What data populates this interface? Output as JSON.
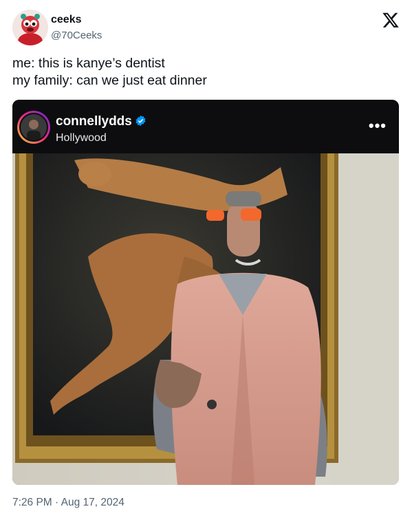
{
  "author": {
    "name": "ceeks",
    "handle": "@70Ceeks"
  },
  "tweet": {
    "lines": [
      "me: this is kanye’s dentist",
      "my family: can we just eat dinner"
    ],
    "timestamp": "7:26 PM · Aug 17, 2024"
  },
  "embed": {
    "username": "connellydds",
    "location": "Hollywood",
    "more": "•••",
    "verified_color": "#0095f6"
  },
  "icons": {
    "platform": "x-logo-icon",
    "verified": "verified-badge-icon",
    "more": "more-options-icon"
  }
}
